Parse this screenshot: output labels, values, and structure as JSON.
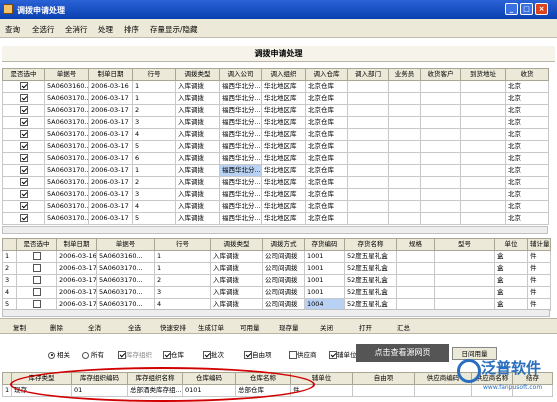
{
  "window": {
    "title": "调拨申请处理"
  },
  "menu": [
    "查询",
    "全选行",
    "全消行",
    "处理",
    "排序",
    "存量显示/隐藏"
  ],
  "panel_title": "调拨申请处理",
  "top_table": {
    "headers": [
      "是否选中",
      "单据号",
      "制单日期",
      "行号",
      "调拨类型",
      "调入公司",
      "调入组织",
      "调入仓库",
      "调入部门",
      "业务员",
      "收货客户",
      "到货地址",
      "收货"
    ],
    "rows": [
      [
        "✓",
        "5A0603160...",
        "2006-03-16",
        "1",
        "入库调拨",
        "福西华北分...",
        "华北地区库",
        "北京仓库",
        "",
        "",
        "",
        "",
        "北京"
      ],
      [
        "✓",
        "5A0603170...",
        "2006-03-17",
        "1",
        "入库调拨",
        "福西华北分...",
        "华北地区库",
        "北京仓库",
        "",
        "",
        "",
        "",
        "北京"
      ],
      [
        "✓",
        "5A0603170...",
        "2006-03-17",
        "2",
        "入库调拨",
        "福西华北分...",
        "华北地区库",
        "北京仓库",
        "",
        "",
        "",
        "",
        "北京"
      ],
      [
        "✓",
        "5A0603170...",
        "2006-03-17",
        "3",
        "入库调拨",
        "福西华北分...",
        "华北地区库",
        "北京仓库",
        "",
        "",
        "",
        "",
        "北京"
      ],
      [
        "✓",
        "5A0603170...",
        "2006-03-17",
        "4",
        "入库调拨",
        "福西华北分...",
        "华北地区库",
        "北京仓库",
        "",
        "",
        "",
        "",
        "北京"
      ],
      [
        "✓",
        "5A0603170...",
        "2006-03-17",
        "5",
        "入库调拨",
        "福西华北分...",
        "华北地区库",
        "北京仓库",
        "",
        "",
        "",
        "",
        "北京"
      ],
      [
        "✓",
        "5A0603170...",
        "2006-03-17",
        "6",
        "入库调拨",
        "福西华北分...",
        "华北地区库",
        "北京仓库",
        "",
        "",
        "",
        "",
        "北京"
      ],
      [
        "✓",
        "5A0603170...",
        "2006-03-17",
        "1",
        "入库调拨",
        "福西华北分...",
        "华北地区库",
        "北京仓库",
        "",
        "",
        "",
        "",
        "北京"
      ],
      [
        "✓",
        "5A0603170...",
        "2006-03-17",
        "2",
        "入库调拨",
        "福西华北分...",
        "华北地区库",
        "北京仓库",
        "",
        "",
        "",
        "",
        "北京"
      ],
      [
        "✓",
        "5A0603170...",
        "2006-03-17",
        "3",
        "入库调拨",
        "福西华北分...",
        "华北地区库",
        "北京仓库",
        "",
        "",
        "",
        "",
        "北京"
      ],
      [
        "✓",
        "5A0603170...",
        "2006-03-17",
        "4",
        "入库调拨",
        "福西华北分...",
        "华北地区库",
        "北京仓库",
        "",
        "",
        "",
        "",
        "北京"
      ],
      [
        "✓",
        "5A0603170...",
        "2006-03-17",
        "5",
        "入库调拨",
        "福西华北分...",
        "华北地区库",
        "北京仓库",
        "",
        "",
        "",
        "",
        "北京"
      ]
    ]
  },
  "mid_table": {
    "headers": [
      "",
      "是否选中",
      "制单日期",
      "单据号",
      "行号",
      "调拨类型",
      "调拨方式",
      "存货编码",
      "存货名称",
      "规格",
      "型号",
      "单位",
      "辅计量"
    ],
    "rows": [
      [
        "1",
        "",
        "2006-03-16",
        "5A0603160...",
        "1",
        "入库调拨",
        "公司间调拨",
        "1001",
        "52度五星礼盒",
        "",
        "",
        "盒",
        "件"
      ],
      [
        "2",
        "",
        "2006-03-17",
        "5A0603170...",
        "1",
        "入库调拨",
        "公司间调拨",
        "1001",
        "52度五星礼盒",
        "",
        "",
        "盒",
        "件"
      ],
      [
        "3",
        "",
        "2006-03-17",
        "5A0603170...",
        "2",
        "入库调拨",
        "公司间调拨",
        "1001",
        "52度五星礼盒",
        "",
        "",
        "盒",
        "件"
      ],
      [
        "4",
        "",
        "2006-03-17",
        "5A0603170...",
        "3",
        "入库调拨",
        "公司间调拨",
        "1001",
        "52度五星礼盒",
        "",
        "",
        "盒",
        "件"
      ],
      [
        "5",
        "",
        "2006-03-17",
        "5A0603170...",
        "4",
        "入库调拨",
        "公司间调拨",
        "1004",
        "52度五星礼盒",
        "",
        "",
        "盒",
        "件"
      ]
    ]
  },
  "toolbar2": [
    "复制",
    "删除",
    "全消",
    "全选",
    "快速安排",
    "生成订单",
    "可用量",
    "现存量",
    "关闭",
    "打开",
    "汇总"
  ],
  "options": [
    {
      "label": "相关",
      "type": "radio",
      "checked": true,
      "dim": false
    },
    {
      "label": "所有",
      "type": "radio",
      "checked": false,
      "dim": false
    },
    {
      "label": "库存组织",
      "type": "check",
      "checked": true,
      "dim": true
    },
    {
      "label": "仓库",
      "type": "check",
      "checked": true,
      "dim": false
    },
    {
      "label": "批次",
      "type": "check",
      "checked": true,
      "dim": false
    },
    {
      "label": "自由项",
      "type": "check",
      "checked": true,
      "dim": false
    },
    {
      "label": "供应商",
      "type": "check",
      "checked": false,
      "dim": false
    },
    {
      "label": "辅单位",
      "type": "check",
      "checked": true,
      "dim": false
    }
  ],
  "tooltip": "点击查看源网页",
  "available_button": "日间用量",
  "bottom_table": {
    "headers": [
      "",
      "库存类型",
      "库存组织编码",
      "库存组织名称",
      "仓库编码",
      "仓库名称",
      "辅单位",
      "自由项",
      "供应商编码",
      "供应商名称",
      "结存"
    ],
    "rows": [
      [
        "1",
        "现存",
        "01",
        "总部酒类库存组...",
        "0101",
        "总部仓库",
        "件",
        "",
        "",
        "",
        ""
      ]
    ]
  },
  "watermark": {
    "name": "泛普软件",
    "url": "www.fanpusoft.com"
  },
  "colors": {
    "title_bar": "#0a3fb0",
    "highlight": "#d00000",
    "selection": "#b9d1f3",
    "logo": "#2a6fbf"
  }
}
